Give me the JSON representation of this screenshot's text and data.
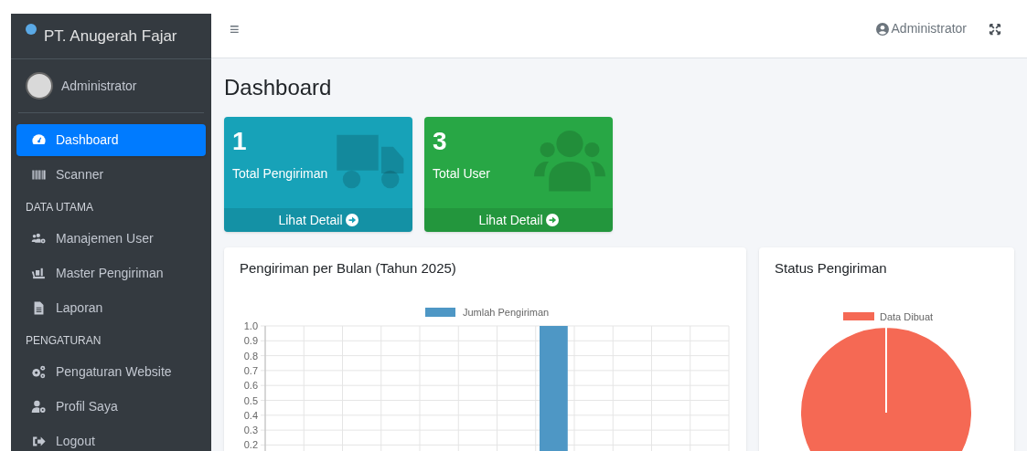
{
  "sidebar": {
    "brand": "PT. Anugerah Fajar",
    "user": "Administrator",
    "items": [
      {
        "kind": "link",
        "label": "Dashboard",
        "selected": true
      },
      {
        "kind": "link",
        "label": "Scanner",
        "selected": false
      },
      {
        "kind": "header",
        "label": "DATA UTAMA"
      },
      {
        "kind": "link",
        "label": "Manajemen User",
        "selected": false
      },
      {
        "kind": "link",
        "label": "Master Pengiriman",
        "selected": false
      },
      {
        "kind": "link",
        "label": "Laporan",
        "selected": false
      },
      {
        "kind": "header",
        "label": "PENGATURAN"
      },
      {
        "kind": "link",
        "label": "Pengaturan Website",
        "selected": false
      },
      {
        "kind": "link",
        "label": "Profil Saya",
        "selected": false
      },
      {
        "kind": "link",
        "label": "Logout",
        "selected": false
      }
    ]
  },
  "navbar": {
    "menu_icon": "≡",
    "user": "Administrator"
  },
  "page_title": "Dashboard",
  "stat_cards": [
    {
      "value": "1",
      "label": "Total Pengiriman",
      "link": "Lihat Detail",
      "color": "#17a2b8"
    },
    {
      "value": "3",
      "label": "Total User",
      "link": "Lihat Detail",
      "color": "#28a745"
    }
  ],
  "charts": [
    {
      "title": "Pengiriman per Bulan (Tahun 2025)",
      "chart_data": {
        "type": "bar",
        "series": [
          {
            "name": "Jumlah Pengiriman",
            "color": "#4e97c5",
            "values": [
              0,
              0,
              0,
              0,
              0,
              0,
              0,
              1,
              0,
              0,
              0,
              0
            ]
          }
        ],
        "ylim": [
          0,
          1
        ],
        "grid": true,
        "yticks": [
          {
            "value": 0.2,
            "label": "0.2"
          },
          {
            "value": 0.3,
            "label": "0.3"
          },
          {
            "value": 0.4,
            "label": "0.4"
          },
          {
            "value": 0.5,
            "label": "0.5"
          },
          {
            "value": 0.6,
            "label": "0.6"
          },
          {
            "value": 0.7,
            "label": "0.7"
          },
          {
            "value": 0.8,
            "label": "0.8"
          },
          {
            "value": 0.9,
            "label": "0.9"
          },
          {
            "value": 1.0,
            "label": "1.0"
          }
        ]
      }
    },
    {
      "title": "Status Pengiriman",
      "chart_data": {
        "type": "pie",
        "series": [
          {
            "name": "Data Dibuat",
            "color": "#f56954",
            "values": [
              1
            ]
          }
        ]
      }
    }
  ]
}
